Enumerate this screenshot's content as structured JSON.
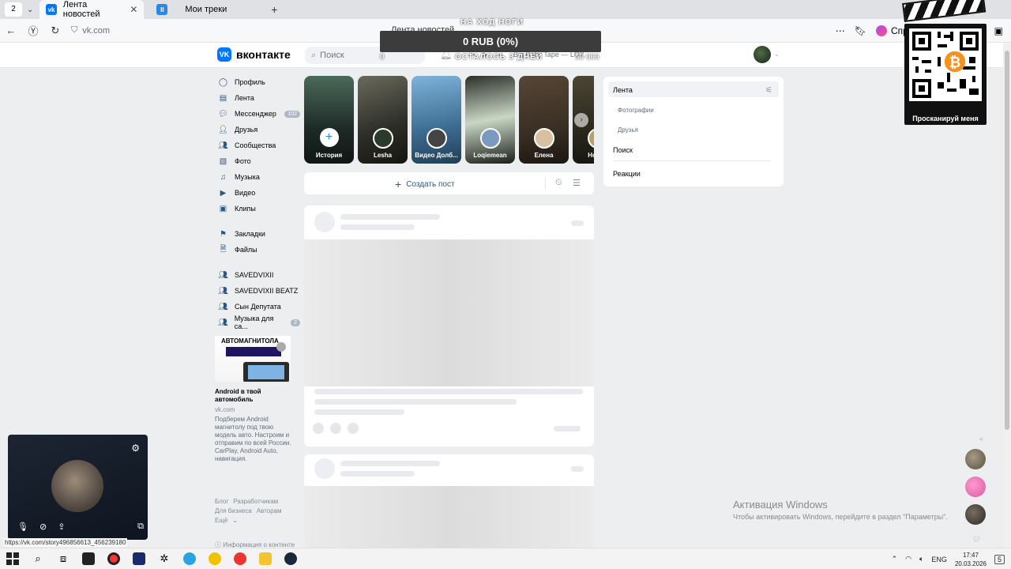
{
  "browser": {
    "tab_count": "2",
    "tabs": [
      {
        "label": "Лента новостей",
        "favicon": "vk-icon",
        "color": "#0077ff"
      },
      {
        "label": "Мои треки",
        "favicon": "music-icon",
        "color": "#2688eb"
      }
    ],
    "url": "vk.com",
    "page_title": "Лента новостей",
    "alice_label": "Спросить Алису AI"
  },
  "donation": {
    "top_text": "НА ХОД НОГИ",
    "amount": "0 RUB (0%)",
    "bottom_text": "ОСТАЛОСЬ 3 ДНЕЙ",
    "start": "0",
    "goal": "50 000"
  },
  "vk": {
    "logo": "вконтакте",
    "search_placeholder": "Поиск",
    "now_playing": "Big Baby Tape — LOX"
  },
  "menu": {
    "items": [
      {
        "label": "Профиль",
        "icon": "profile-icon"
      },
      {
        "label": "Лента",
        "icon": "news-icon"
      },
      {
        "label": "Мессенджер",
        "icon": "messenger-icon",
        "badge": "102"
      },
      {
        "label": "Друзья",
        "icon": "friends-icon"
      },
      {
        "label": "Сообщества",
        "icon": "communities-icon"
      },
      {
        "label": "Фото",
        "icon": "photo-icon"
      },
      {
        "label": "Музыка",
        "icon": "music-icon"
      },
      {
        "label": "Видео",
        "icon": "video-icon"
      },
      {
        "label": "Клипы",
        "icon": "clips-icon"
      }
    ],
    "items2": [
      {
        "label": "Закладки",
        "icon": "bookmarks-icon"
      },
      {
        "label": "Файлы",
        "icon": "files-icon"
      }
    ],
    "groups": [
      {
        "label": "SAVEDVIXII"
      },
      {
        "label": "SAVEDVIXII BEATZ"
      },
      {
        "label": "Сын Депутата"
      },
      {
        "label": "Музыка для са...",
        "badge": "2"
      }
    ]
  },
  "ad": {
    "image_title": "АВТОМАГНИТОЛА",
    "headline": "Android в твой автомобиль",
    "source": "vk.com",
    "text": "Подберем Android магнитолу под твою модель авто. Настроим и отправим по всей России. CarPlay, Android Auto, навигация."
  },
  "footer": {
    "links": [
      "Блог",
      "Разработчикам",
      "Для бизнеса",
      "Авторам",
      "Ещё"
    ],
    "info": "Информация о контенте"
  },
  "stories": [
    {
      "name": "История",
      "bg": "#2a3b3a"
    },
    {
      "name": "Lesha",
      "bg": "#3b3d33"
    },
    {
      "name": "Видео Долб...",
      "bg": "#4b7ea8"
    },
    {
      "name": "Loqiemean",
      "bg": "#2f3a2e"
    },
    {
      "name": "Елена",
      "bg": "#3d3428"
    },
    {
      "name": "Новая",
      "bg": "#2c2a22"
    }
  ],
  "composer": {
    "create_label": "Создать пост"
  },
  "filter": {
    "feed": "Лента",
    "photos": "Фотографии",
    "friends": "Друзья",
    "search": "Поиск",
    "reactions": "Реакции"
  },
  "qr": {
    "caption": "Просканируй меня"
  },
  "status_url": "https://vk.com/story496856613_456239180",
  "activation": {
    "title": "Активация Windows",
    "subtitle": "Чтобы активировать Windows, перейдите в раздел \"Параметры\"."
  },
  "taskbar": {
    "lang": "ENG",
    "time": "17:47",
    "date": "20.03.2026",
    "notifications": "5"
  }
}
